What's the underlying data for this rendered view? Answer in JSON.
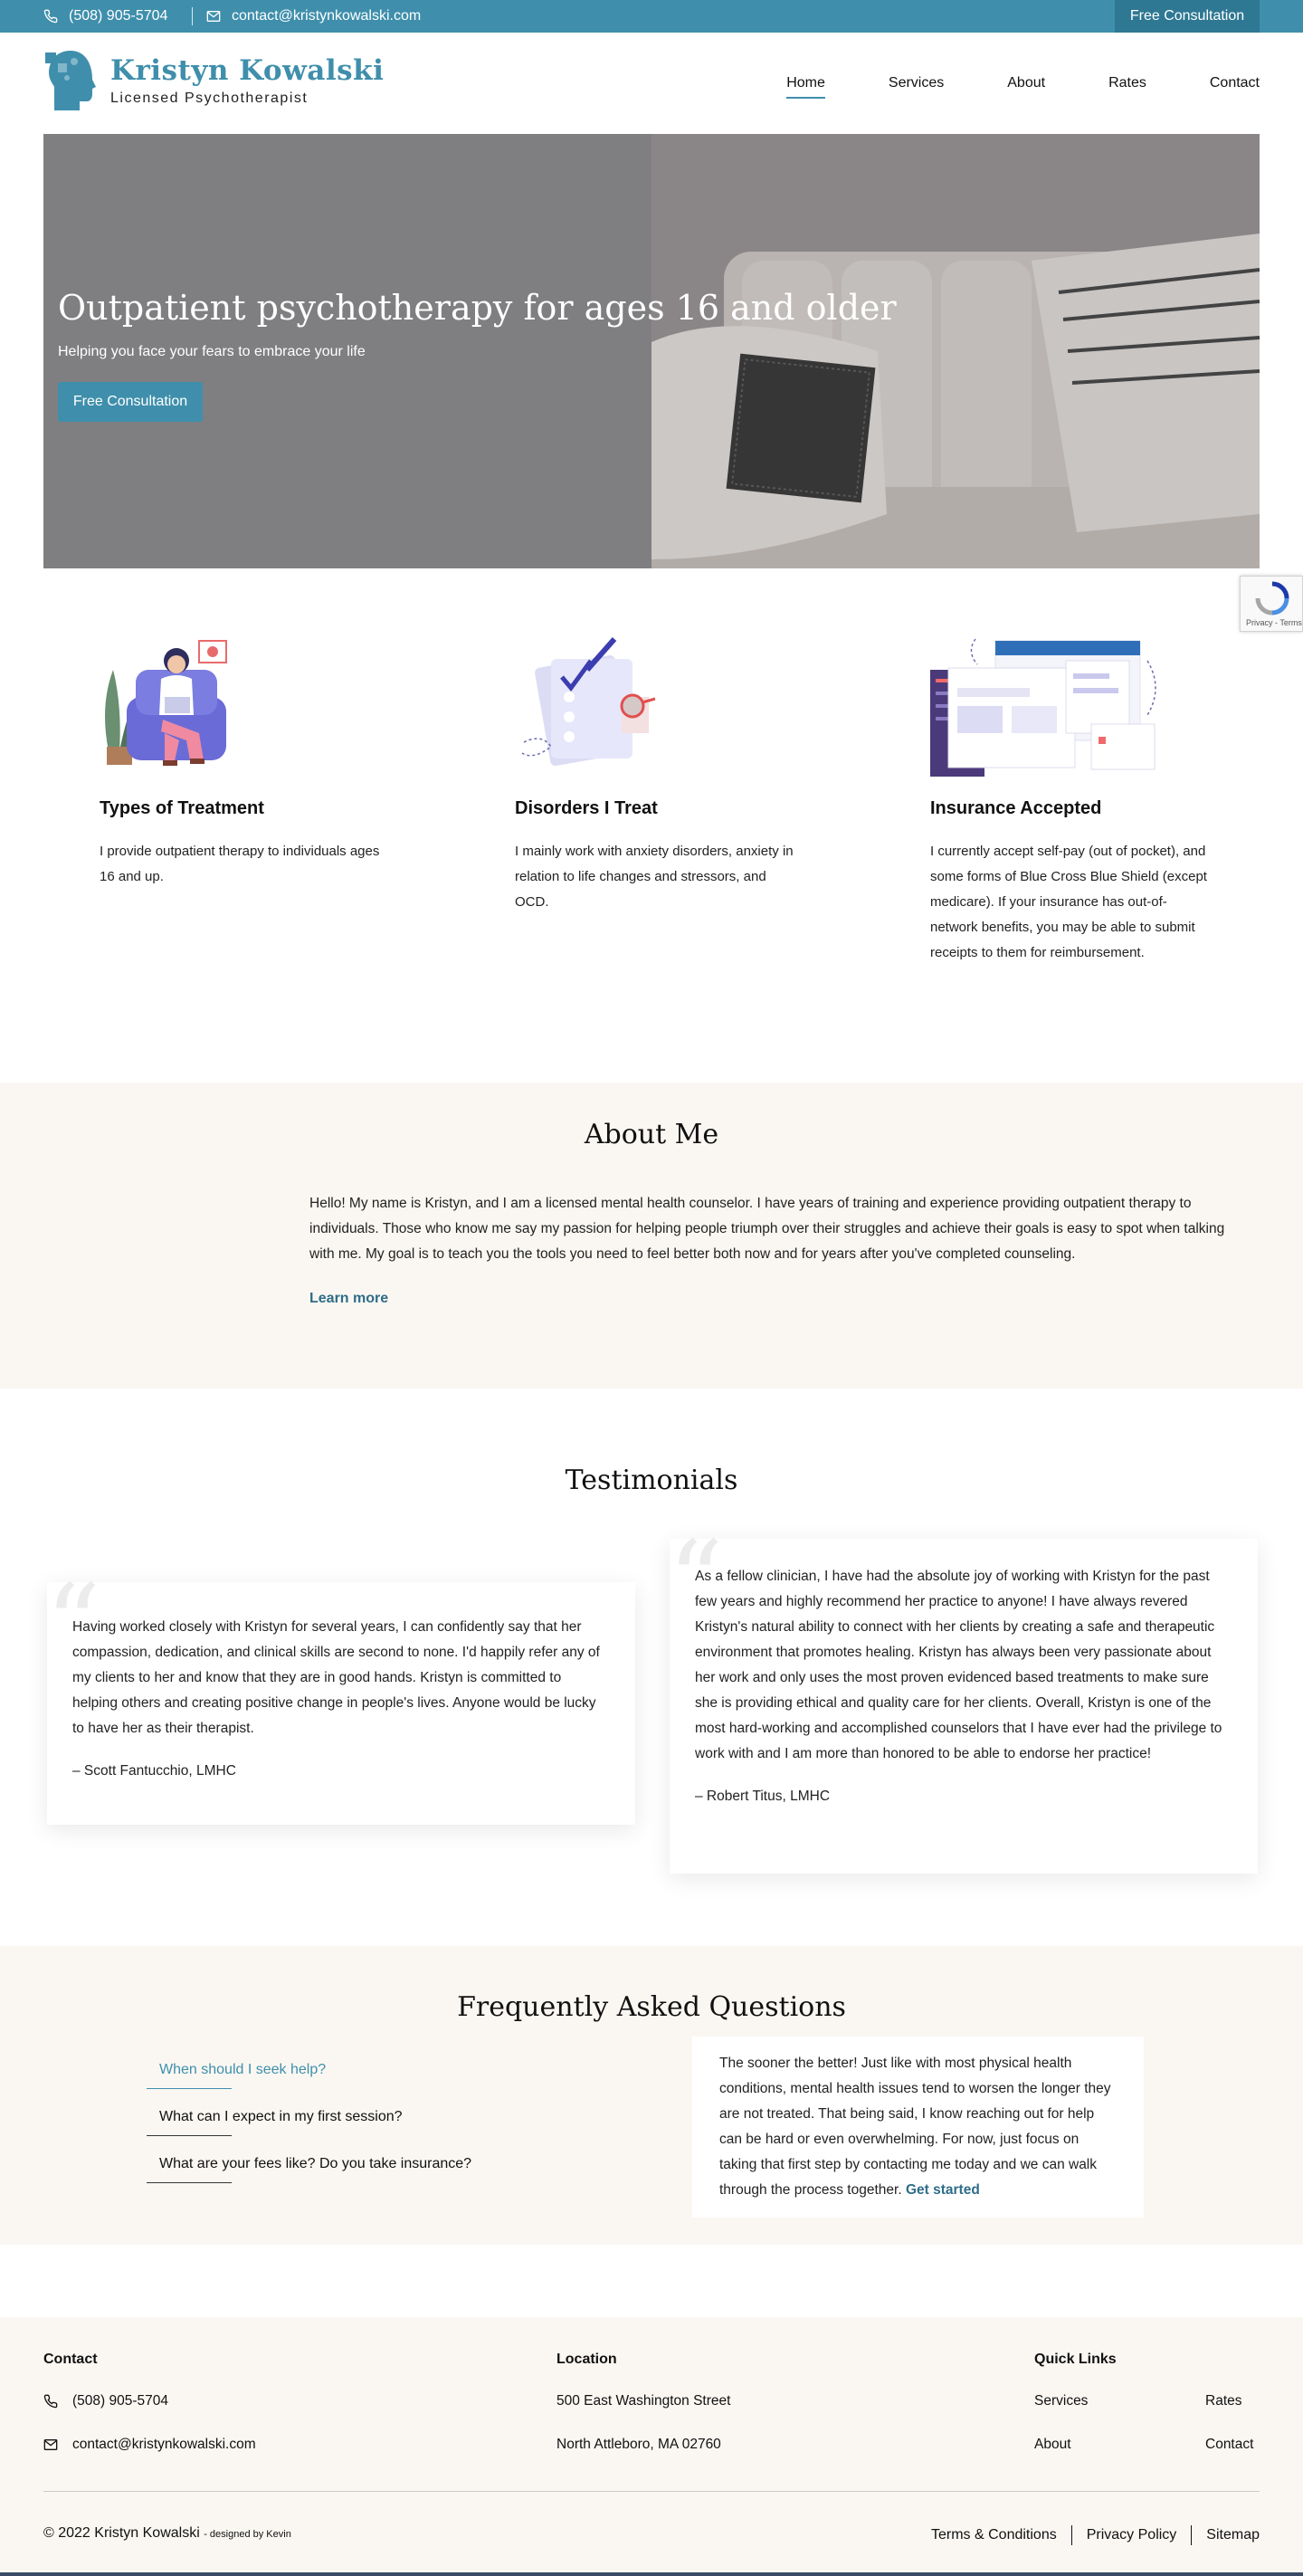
{
  "topbar": {
    "phone": "(508) 905-5704",
    "email": "contact@kristynkowalski.com",
    "cta": "Free Consultation",
    "phone_icon": "phone-icon",
    "email_icon": "envelope-icon"
  },
  "brand": {
    "name": "Kristyn Kowalski",
    "subtitle": "Licensed Psychotherapist",
    "accent_color": "#3f8fac"
  },
  "nav": {
    "items": [
      "Home",
      "Services",
      "About",
      "Rates",
      "Contact"
    ],
    "active": "Home"
  },
  "hero": {
    "title": "Outpatient psychotherapy for ages 16 and older",
    "subtitle": "Helping you face your fears to embrace your life",
    "button": "Free Consultation"
  },
  "recaptcha": {
    "text": "Privacy - Terms"
  },
  "features": [
    {
      "title": "Types of Treatment",
      "text": "I provide outpatient therapy to individuals ages 16 and up."
    },
    {
      "title": "Disorders I Treat",
      "text": "I mainly work with anxiety disorders, anxiety in relation to life changes and stressors, and OCD."
    },
    {
      "title": "Insurance Accepted",
      "text": "I currently accept self-pay (out of pocket), and some forms of Blue Cross Blue Shield (except medicare). If your insurance has out-of-network benefits, you may be able to submit receipts to them for reimbursement."
    }
  ],
  "about": {
    "title": "About Me",
    "text": "Hello! My name is Kristyn, and I am a licensed mental health counselor. I have years of training and experience providing outpatient therapy to individuals. Those who know me say my passion for helping people triumph over their struggles and achieve their goals is easy to spot when talking with me. My goal is to teach you the tools you need to feel better both now and for years after you've completed counseling.",
    "link": "Learn more"
  },
  "testimonials": {
    "title": "Testimonials",
    "items": [
      {
        "text": "Having worked closely with Kristyn for several years, I can confidently say that her compassion, dedication, and clinical skills are second to none. I'd happily refer any of my clients to her and know that they are in good hands. Kristyn is committed to helping others and creating positive change in people's lives. Anyone would be lucky to have her as their therapist.",
        "author": "– Scott Fantucchio, LMHC"
      },
      {
        "text": "As a fellow clinician, I have had the absolute joy of working with Kristyn for the past few years and highly recommend her practice to anyone! I have always revered Kristyn's natural ability to connect with her clients by creating a safe and therapeutic environment that promotes healing. Kristyn has always been very passionate about her work and only uses the most proven evidenced based treatments to make sure she is providing ethical and quality care for her clients. Overall, Kristyn is one of the most hard-working and accomplished counselors that I have ever had the privilege to work with and I am more than honored to be able to endorse her practice!",
        "author": "– Robert Titus, LMHC"
      }
    ]
  },
  "faq": {
    "title": "Frequently Asked Questions",
    "questions": [
      "When should I seek help?",
      "What can I expect in my first session?",
      "What are your fees like? Do you take insurance?"
    ],
    "active_index": 0,
    "answer": "The sooner the better! Just like with most physical health conditions, mental health issues tend to worsen the longer they are not treated. That being said, I know reaching out for help can be hard or even overwhelming. For now, just focus on taking that first step by contacting me today and we can walk through the process together.",
    "answer_link": "Get started"
  },
  "footer": {
    "contact_heading": "Contact",
    "phone": "(508) 905-5704",
    "email": "contact@kristynkowalski.com",
    "location_heading": "Location",
    "address_line1": "500 East Washington Street",
    "address_line2": "North Attleboro, MA 02760",
    "links_heading": "Quick Links",
    "links": [
      "Services",
      "Rates",
      "About",
      "Contact"
    ],
    "copyright": "© 2022 Kristyn Kowalski",
    "designed_by": "- designed by Kevin",
    "legal": [
      "Terms & Conditions",
      "Privacy Policy",
      "Sitemap"
    ]
  }
}
